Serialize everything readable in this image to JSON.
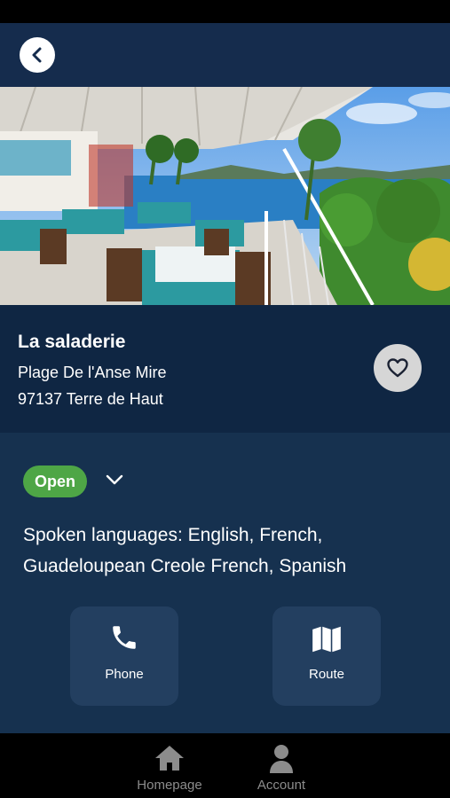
{
  "restaurant": {
    "name": "La saladerie",
    "address_line1": "Plage De l'Anse Mire",
    "address_line2": "97137 Terre de Haut"
  },
  "status": {
    "badge": "Open",
    "badge_color": "#4ea646"
  },
  "languages_text": "Spoken languages: English, French, Guadeloupean Creole French, Spanish",
  "actions": {
    "phone_label": "Phone",
    "route_label": "Route"
  },
  "tabs": {
    "home_label": "Homepage",
    "account_label": "Account"
  },
  "icons": {
    "back": "chevron-left-icon",
    "favorite": "heart-outline-icon",
    "expand": "chevron-down-icon",
    "phone": "phone-icon",
    "route": "map-icon",
    "home": "home-icon",
    "account": "user-icon"
  },
  "colors": {
    "header_bg": "#152c4d",
    "info_bg": "#0f2643",
    "details_bg": "#16314f",
    "button_bg": "#233f60"
  }
}
